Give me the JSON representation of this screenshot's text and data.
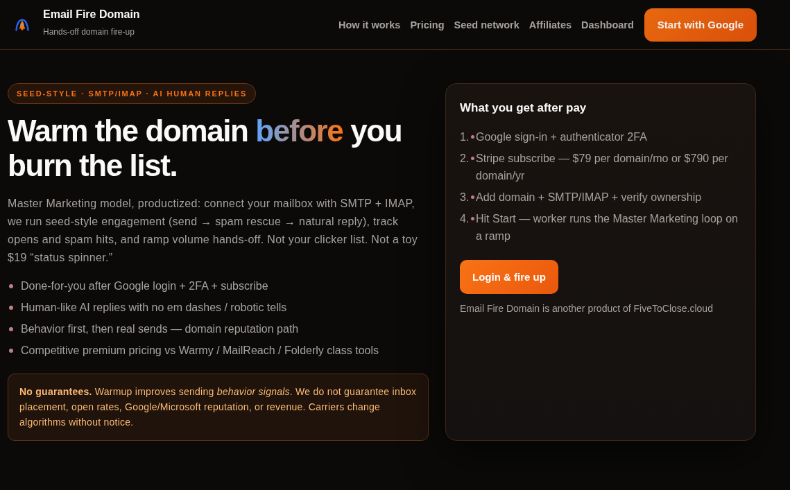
{
  "header": {
    "brand": {
      "title": "Email Fire Domain",
      "tagline": "Hands-off domain fire-up"
    },
    "nav": [
      {
        "label": "How it works"
      },
      {
        "label": "Pricing"
      },
      {
        "label": "Seed network"
      },
      {
        "label": "Affiliates"
      },
      {
        "label": "Dashboard"
      }
    ],
    "cta": "Start with Google"
  },
  "hero": {
    "badge": "SEED-STYLE · SMTP/IMAP · AI HUMAN REPLIES",
    "headline": {
      "lead": "Warm the domain ",
      "highlight": "before",
      "tail": " you burn the list."
    },
    "intro": "Master Marketing model, productized: connect your mailbox with SMTP + IMAP, we run seed-style engagement (send → spam rescue → natural reply), track opens and spam hits, and ramp volume hands-off. Not your clicker list. Not a toy $19 “status spinner.”",
    "features": [
      "Done-for-you after Google login + 2FA + subscribe",
      "Human-like AI replies with no em dashes / robotic tells",
      "Behavior first, then real sends — domain reputation path",
      "Competitive premium pricing vs Warmy / MailReach / Folderly class tools"
    ],
    "notice": "**No guarantees.** Warmup improves sending *behavior signals*. We do not guarantee inbox placement, open rates, Google/Microsoft reputation, or revenue. Carriers change algorithms without notice."
  },
  "card": {
    "title": "What you get after pay",
    "steps": [
      {
        "number": "1.",
        "text": "Google sign-in + authenticator 2FA"
      },
      {
        "number": "2.",
        "text": "Stripe subscribe — $79 per domain/mo or $790 per domain/yr"
      },
      {
        "number": "3.",
        "text": "Add domain + SMTP/IMAP + verify ownership"
      },
      {
        "number": "4.",
        "text": "Hit Start — worker runs the Master Marketing loop on a ramp"
      }
    ],
    "button": "Login & fire up",
    "footnote": "Email Fire Domain is another product of FiveToClose.cloud"
  }
}
